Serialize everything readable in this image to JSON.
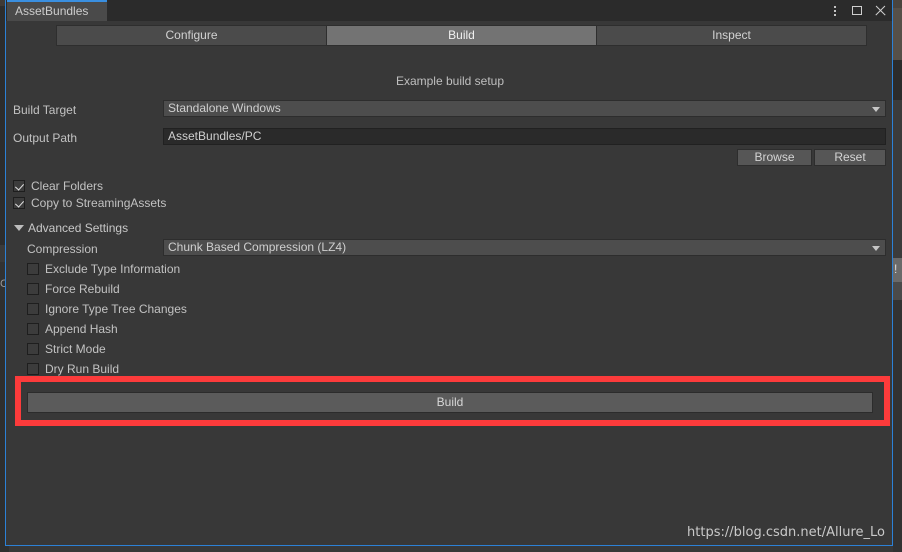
{
  "window": {
    "tab_title": "AssetBundles",
    "controls": [
      {
        "name": "kebab-menu-icon",
        "label": "⋮"
      },
      {
        "name": "maximize-icon",
        "label": "□"
      },
      {
        "name": "close-icon",
        "label": "✕"
      }
    ]
  },
  "background": {
    "left_glyph": "C",
    "right_glyph": "!"
  },
  "tabs": [
    {
      "label": "Configure",
      "selected": false
    },
    {
      "label": "Build",
      "selected": true
    },
    {
      "label": "Inspect",
      "selected": false
    }
  ],
  "subtitle": "Example build setup",
  "fields": {
    "build_target": {
      "label": "Build Target",
      "value": "Standalone Windows",
      "type": "dropdown"
    },
    "output_path": {
      "label": "Output Path",
      "value": "AssetBundles/PC",
      "type": "text"
    },
    "compression": {
      "label": "Compression",
      "value": "Chunk Based Compression (LZ4)",
      "type": "dropdown"
    }
  },
  "buttons": {
    "browse": "Browse",
    "reset": "Reset",
    "build": "Build"
  },
  "toggles": [
    {
      "label": "Clear Folders",
      "checked": true
    },
    {
      "label": "Copy to StreamingAssets",
      "checked": true
    }
  ],
  "advanced": {
    "header": "Advanced Settings",
    "expanded": true,
    "toggles": [
      {
        "label": "Exclude Type Information",
        "checked": false
      },
      {
        "label": "Force Rebuild",
        "checked": false
      },
      {
        "label": "Ignore Type Tree Changes",
        "checked": false
      },
      {
        "label": "Append Hash",
        "checked": false
      },
      {
        "label": "Strict Mode",
        "checked": false
      },
      {
        "label": "Dry Run Build",
        "checked": false
      }
    ]
  },
  "annotation": {
    "color": "#fc3b3b",
    "target": "build-button"
  },
  "watermark": "https://blog.csdn.net/Allure_Lo"
}
